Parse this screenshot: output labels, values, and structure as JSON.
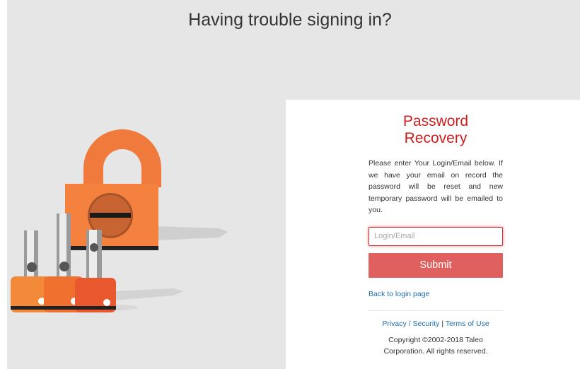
{
  "page": {
    "heading": "Having trouble signing in?"
  },
  "recovery": {
    "title_line1": "Password",
    "title_line2": "Recovery",
    "instructions": "Please enter Your Login/Email below. If we have your email on record the password will be reset and new temporary password will be emailed to you.",
    "login_field": {
      "value": "",
      "placeholder": "Login/Email"
    },
    "submit_label": "Submit",
    "back_link": "Back to login page"
  },
  "footer": {
    "privacy_link": "Privacy / Security",
    "separator": "|",
    "terms_link": "Terms of Use",
    "copyright_line1": "Copyright ©2002-2018 Taleo",
    "copyright_line2": "Corporation. All rights reserved."
  },
  "colors": {
    "page_background": "#e6e6e6",
    "panel_background": "#ffffff",
    "title_red": "#cc1f1f",
    "submit_red": "#e06060",
    "link_blue": "#1f6fb0",
    "padlock_orange": "#f07a3c"
  },
  "icons": [
    "padlock-icon",
    "keys-icon"
  ]
}
